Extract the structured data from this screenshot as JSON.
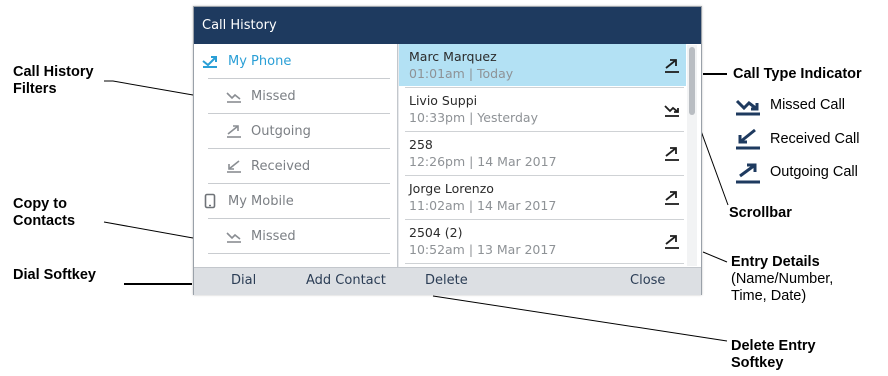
{
  "screen": {
    "title": "Call History",
    "filters": [
      {
        "label": "My Phone",
        "icon": "phone-filter-icon",
        "active": true
      },
      {
        "label": "Missed",
        "icon": "missed-call-icon"
      },
      {
        "label": "Outgoing",
        "icon": "outgoing-call-icon"
      },
      {
        "label": "Received",
        "icon": "received-call-icon"
      },
      {
        "label": "My Mobile",
        "icon": "mobile-icon"
      },
      {
        "label": "Missed",
        "icon": "missed-call-icon"
      }
    ],
    "entries": [
      {
        "name": "Marc Marquez",
        "time": "01:01am | Today",
        "type": "outgoing",
        "selected": true
      },
      {
        "name": "Livio Suppi",
        "time": "10:33pm | Yesterday",
        "type": "missed"
      },
      {
        "name": "258",
        "time": "12:26pm | 14 Mar 2017",
        "type": "outgoing"
      },
      {
        "name": "Jorge Lorenzo",
        "time": "11:02am | 14 Mar 2017",
        "type": "outgoing"
      },
      {
        "name": "2504 (2)",
        "time": "10:52am | 13 Mar 2017",
        "type": "outgoing"
      }
    ],
    "softkeys": {
      "dial": "Dial",
      "add_contact": "Add Contact",
      "delete": "Delete",
      "close": "Close"
    }
  },
  "callouts": {
    "filters": [
      "Call History",
      "Filters"
    ],
    "copy": [
      "Copy to",
      "Contacts"
    ],
    "dial": "Dial Softkey",
    "type_indicator": "Call Type Indicator",
    "scrollbar": "Scrollbar",
    "entry_details": "Entry Details",
    "entry_details_sub": [
      "(Name/Number,",
      "Time, Date)"
    ],
    "delete": [
      "Delete Entry",
      "Softkey"
    ]
  },
  "legend": {
    "missed": "Missed Call",
    "received": "Received Call",
    "outgoing": "Outgoing Call"
  },
  "colors": {
    "titlebar": "#1e3a5f",
    "accent": "#2a9fd6",
    "selected_row": "#b3e1f4",
    "legend_icon": "#1e3a5f"
  }
}
